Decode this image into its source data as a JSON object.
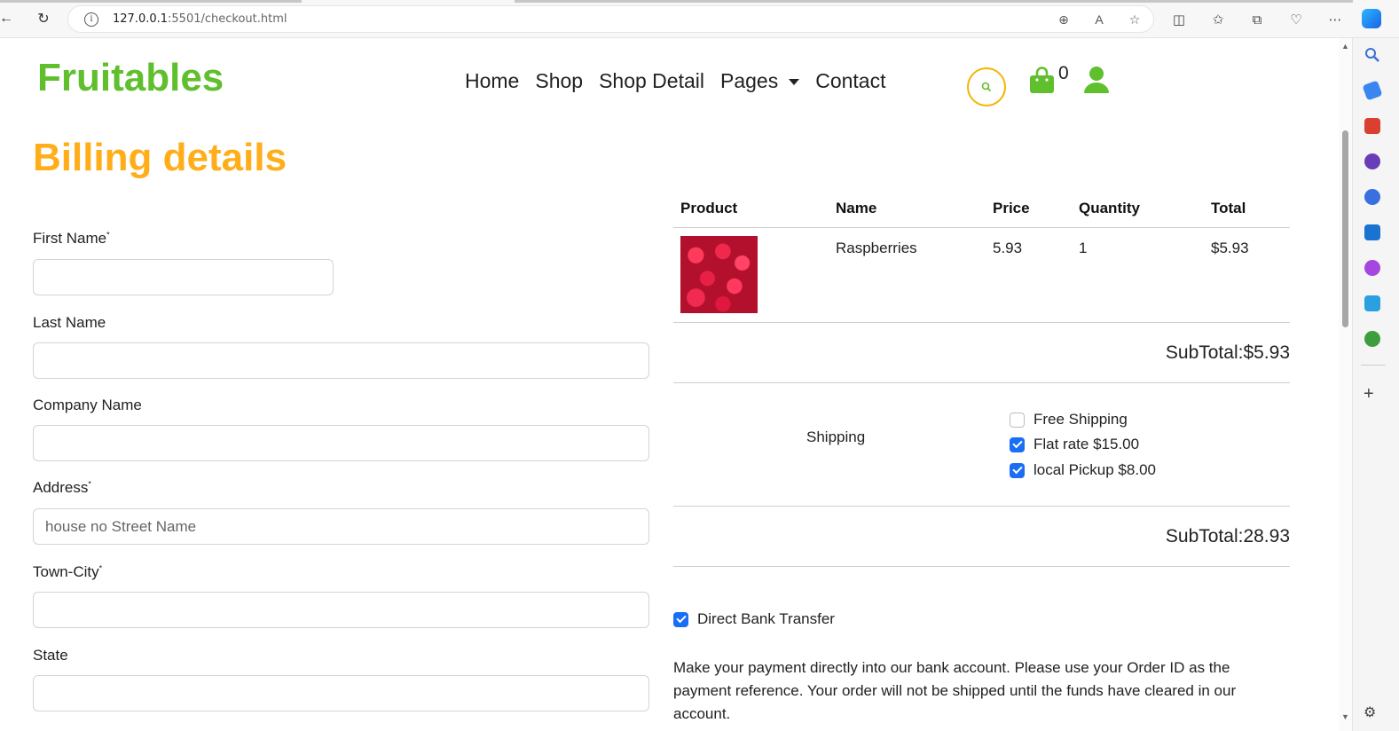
{
  "browser": {
    "url_host": "127.0.0.1",
    "url_path": ":5501/checkout.html"
  },
  "header": {
    "brand": "Fruitables",
    "nav": [
      "Home",
      "Shop",
      "Shop Detail",
      "Pages",
      "Contact"
    ],
    "cart_count": "0"
  },
  "page": {
    "title": "Billing details"
  },
  "form": {
    "first_name_label": "First Name",
    "first_name_mark": "*",
    "last_name_label": "Last Name",
    "company_label": "Company Name",
    "address_label": "Address",
    "address_mark": "*",
    "address_placeholder": "house no Street Name",
    "town_label": "Town-City",
    "town_mark": "*",
    "state_label": "State"
  },
  "order": {
    "headers": [
      "Product",
      "Name",
      "Price",
      "Quantity",
      "Total"
    ],
    "item": {
      "name": "Raspberries",
      "price": "5.93",
      "quantity": "1",
      "total": "$5.93"
    },
    "subtotal": "SubTotal:$5.93",
    "shipping_label": "Shipping",
    "shipping_options": [
      {
        "label": "Free Shipping",
        "checked": false
      },
      {
        "label": "Flat rate $15.00",
        "checked": true
      },
      {
        "label": "local Pickup $8.00",
        "checked": true
      }
    ],
    "grand_subtotal": "SubTotal:28.93",
    "payment_label": "Direct Bank Transfer",
    "payment_note": "Make your payment directly into our bank account. Please use your Order ID as the payment reference. Your order will not be shipped until the funds have cleared in our account."
  },
  "colors": {
    "brand_green": "#5fbf2d",
    "title_orange": "#ffae1a",
    "checkbox_blue": "#1a6ef5"
  }
}
